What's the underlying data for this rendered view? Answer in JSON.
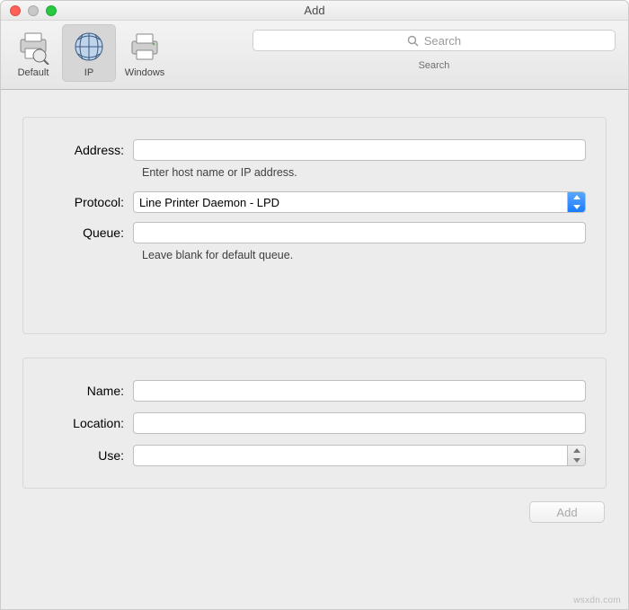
{
  "window": {
    "title": "Add"
  },
  "toolbar": {
    "items": [
      {
        "label": "Default"
      },
      {
        "label": "IP"
      },
      {
        "label": "Windows"
      }
    ],
    "search_placeholder": "Search",
    "search_sublabel": "Search"
  },
  "form": {
    "address": {
      "label": "Address:",
      "value": "",
      "hint": "Enter host name or IP address."
    },
    "protocol": {
      "label": "Protocol:",
      "value": "Line Printer Daemon - LPD"
    },
    "queue": {
      "label": "Queue:",
      "value": "",
      "hint": "Leave blank for default queue."
    },
    "name": {
      "label": "Name:",
      "value": ""
    },
    "location": {
      "label": "Location:",
      "value": ""
    },
    "use": {
      "label": "Use:",
      "value": ""
    }
  },
  "buttons": {
    "add": "Add"
  },
  "watermark": "wsxdn.com"
}
